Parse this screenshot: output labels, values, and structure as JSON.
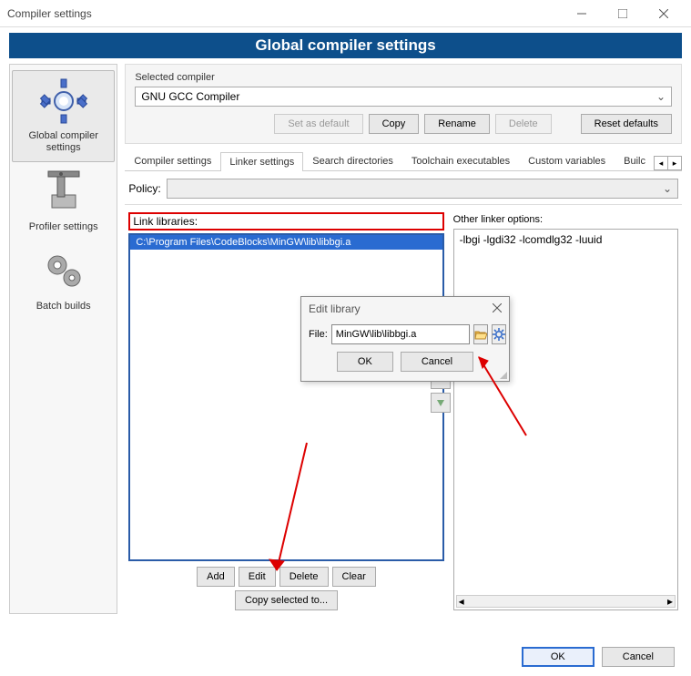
{
  "window": {
    "title": "Compiler settings"
  },
  "banner": "Global compiler settings",
  "sidebar": {
    "items": [
      {
        "label": "Global compiler settings"
      },
      {
        "label": "Profiler settings"
      },
      {
        "label": "Batch builds"
      }
    ]
  },
  "selected_compiler": {
    "group_title": "Selected compiler",
    "value": "GNU GCC Compiler",
    "buttons": {
      "set_default": "Set as default",
      "copy": "Copy",
      "rename": "Rename",
      "delete": "Delete",
      "reset": "Reset defaults"
    }
  },
  "tabs": {
    "items": [
      "Compiler settings",
      "Linker settings",
      "Search directories",
      "Toolchain executables",
      "Custom variables",
      "Builc"
    ],
    "active_index": 1
  },
  "policy": {
    "label": "Policy:",
    "value": ""
  },
  "linker": {
    "link_libraries_label": "Link libraries:",
    "link_libraries": [
      "C:\\Program Files\\CodeBlocks\\MinGW\\lib\\libbgi.a"
    ],
    "other_options_label": "Other linker options:",
    "other_options": "-lbgi -lgdi32 -lcomdlg32 -luuid",
    "buttons": {
      "add": "Add",
      "edit": "Edit",
      "delete": "Delete",
      "clear": "Clear",
      "copy_selected": "Copy selected to..."
    }
  },
  "edit_dialog": {
    "title": "Edit library",
    "file_label": "File:",
    "file_value": "MinGW\\lib\\libbgi.a",
    "ok": "OK",
    "cancel": "Cancel"
  },
  "footer": {
    "ok": "OK",
    "cancel": "Cancel"
  }
}
